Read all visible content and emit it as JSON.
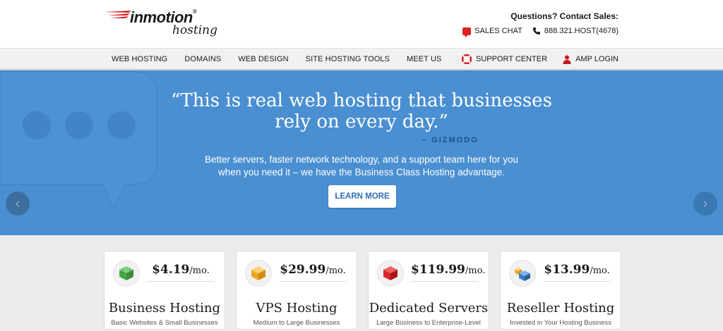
{
  "header": {
    "logo_main": "inmotion",
    "logo_reg": "®",
    "logo_sub": "hosting",
    "contact_title": "Questions? Contact Sales:",
    "sales_chat": "SALES CHAT",
    "phone": "888.321.HOST(4678)"
  },
  "nav": {
    "items": [
      "WEB HOSTING",
      "DOMAINS",
      "WEB DESIGN",
      "SITE HOSTING TOOLS",
      "MEET US"
    ],
    "support": "SUPPORT CENTER",
    "login": "AMP LOGIN"
  },
  "hero": {
    "quote_line1": "“This is real web hosting that businesses",
    "quote_line2": "rely on every day.”",
    "attribution": "– GIZMODO",
    "desc_line1": "Better servers, faster network technology, and a support team here for you",
    "desc_line2": "when you need it – we have the Business Class Hosting advantage.",
    "button": "LEARN MORE",
    "prev": "‹",
    "next": "›",
    "color": "#4a8fd1"
  },
  "plans": [
    {
      "price": "$4.19",
      "unit": "/mo.",
      "name": "Business Hosting",
      "sub": "Basic Websites & Small Businesses",
      "icon": "green-cube-icon",
      "color": "#5cb85c"
    },
    {
      "price": "$29.99",
      "unit": "/mo.",
      "name": "VPS Hosting",
      "sub": "Medium to Large Businesses",
      "icon": "orange-cube-icon",
      "color": "#f0ad2b"
    },
    {
      "price": "$119.99",
      "unit": "/mo.",
      "name": "Dedicated Servers",
      "sub": "Large Business to Enterprise-Level",
      "icon": "red-cube-icon",
      "color": "#d9262b"
    },
    {
      "price": "$13.99",
      "unit": "/mo.",
      "name": "Reseller Hosting",
      "sub": "Invested in Your Hosting Business",
      "icon": "blue-cubes-icon",
      "color": "#3b7fc4"
    }
  ]
}
